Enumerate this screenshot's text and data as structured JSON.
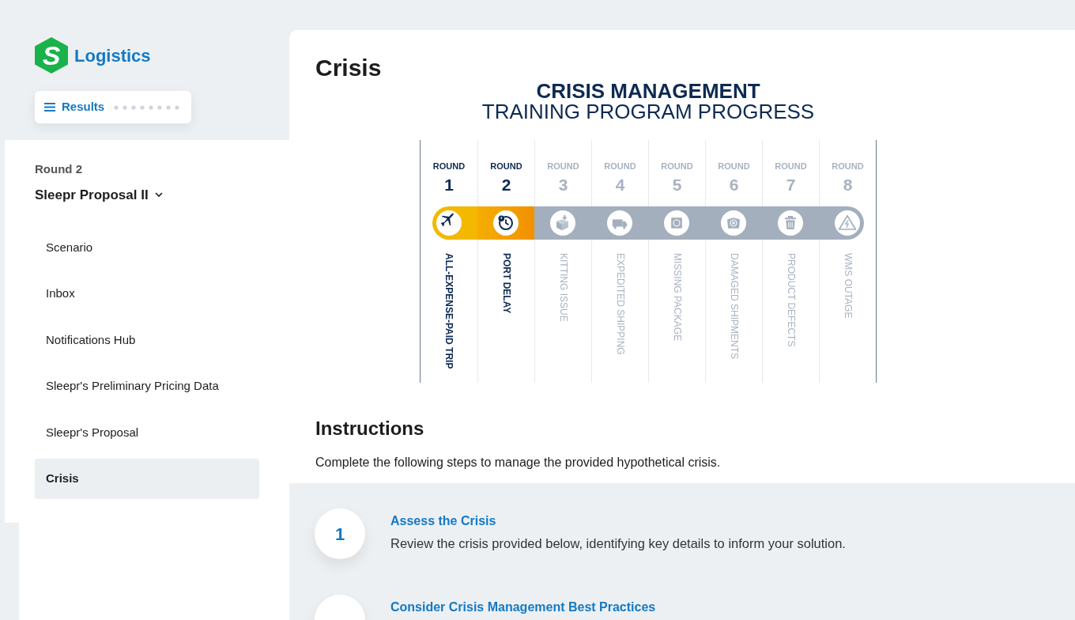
{
  "brand": {
    "letter": "S",
    "name": "Logistics"
  },
  "results_button": {
    "label": "Results"
  },
  "sidebar": {
    "round": "Round 2",
    "title": "Sleepr Proposal II",
    "items": [
      {
        "label": "Scenario",
        "selected": false
      },
      {
        "label": "Inbox",
        "selected": false
      },
      {
        "label": "Notifications Hub",
        "selected": false
      },
      {
        "label": "Sleepr's Preliminary Pricing Data",
        "selected": false
      },
      {
        "label": "Sleepr's Proposal",
        "selected": false
      },
      {
        "label": "Crisis",
        "selected": true
      }
    ]
  },
  "page": {
    "title": "Crisis"
  },
  "infographic": {
    "title": "CRISIS MANAGEMENT",
    "subtitle": "TRAINING PROGRAM PROGRESS",
    "rounds": [
      {
        "label": "ROUND",
        "number": "1",
        "crisis": "ALL-EXPENSE-PAID TRIP",
        "completed": true
      },
      {
        "label": "ROUND",
        "number": "2",
        "crisis": "PORT DELAY",
        "completed": true
      },
      {
        "label": "ROUND",
        "number": "3",
        "crisis": "KITTING ISSUE",
        "completed": false
      },
      {
        "label": "ROUND",
        "number": "4",
        "crisis": "EXPEDITED SHIPPING",
        "completed": false
      },
      {
        "label": "ROUND",
        "number": "5",
        "crisis": "MISSING PACKAGE",
        "completed": false
      },
      {
        "label": "ROUND",
        "number": "6",
        "crisis": "DAMAGED SHIPMENTS",
        "completed": false
      },
      {
        "label": "ROUND",
        "number": "7",
        "crisis": "PRODUCT DEFECTS",
        "completed": false
      },
      {
        "label": "ROUND",
        "number": "8",
        "crisis": "WMS OUTAGE",
        "completed": false
      }
    ]
  },
  "instructions": {
    "title": "Instructions",
    "intro": "Complete the following steps to manage the provided hypothetical crisis.",
    "steps": [
      {
        "number": "1",
        "title": "Assess the Crisis",
        "text": "Review the crisis provided below, identifying key details to inform your solution."
      },
      {
        "title": "Consider Crisis Management Best Practices"
      }
    ]
  }
}
